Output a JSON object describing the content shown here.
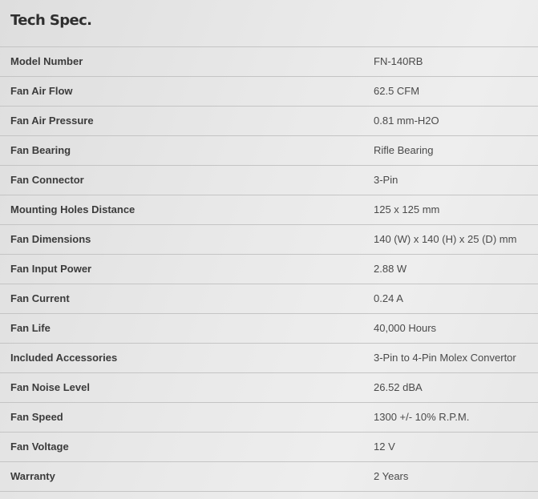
{
  "section": {
    "title": "Tech Spec."
  },
  "specs": [
    {
      "label": "Model Number",
      "value": "FN-140RB"
    },
    {
      "label": "Fan Air Flow",
      "value": "62.5 CFM"
    },
    {
      "label": "Fan Air Pressure",
      "value": "0.81 mm-H2O"
    },
    {
      "label": "Fan Bearing",
      "value": "Rifle Bearing"
    },
    {
      "label": "Fan Connector",
      "value": "3-Pin"
    },
    {
      "label": "Mounting Holes Distance",
      "value": "125 x 125 mm"
    },
    {
      "label": "Fan Dimensions",
      "value": "140 (W) x 140 (H) x 25 (D) mm"
    },
    {
      "label": "Fan Input Power",
      "value": "2.88 W"
    },
    {
      "label": "Fan Current",
      "value": "0.24 A"
    },
    {
      "label": "Fan Life",
      "value": "40,000 Hours"
    },
    {
      "label": "Included Accessories",
      "value": "3-Pin to 4-Pin Molex Convertor"
    },
    {
      "label": "Fan Noise Level",
      "value": "26.52 dBA"
    },
    {
      "label": "Fan Speed",
      "value": "1300 +/- 10% R.P.M."
    },
    {
      "label": "Fan Voltage",
      "value": "12 V"
    },
    {
      "label": "Warranty",
      "value": "2 Years"
    }
  ]
}
